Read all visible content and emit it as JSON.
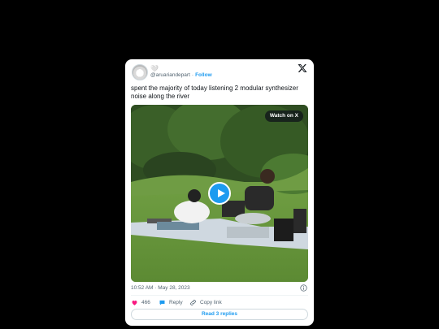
{
  "tweet": {
    "display_name": "🤍",
    "handle": "@aruariandepart",
    "follow_label": "Follow",
    "text": "spent the majority of today listening 2 modular synthesizer noise along the river",
    "timestamp": "10:52 AM · May 28, 2023"
  },
  "media": {
    "watch_label": "Watch on X"
  },
  "actions": {
    "like_count": "466",
    "reply_label": "Reply",
    "copy_label": "Copy link"
  },
  "footer": {
    "read_replies_label": "Read 3 replies"
  },
  "colors": {
    "accent": "#1d9bf0",
    "like": "#f91880",
    "background": "#000000"
  }
}
